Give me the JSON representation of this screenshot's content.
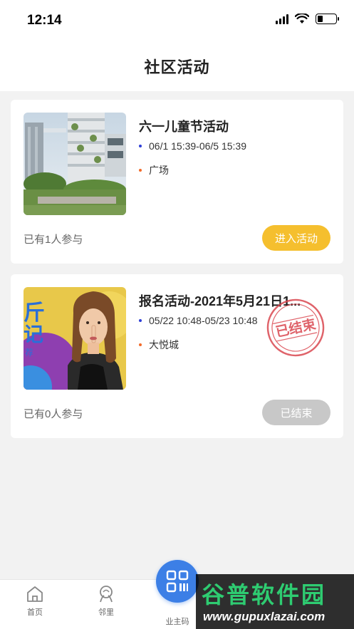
{
  "status_bar": {
    "time": "12:14"
  },
  "header": {
    "title": "社区活动"
  },
  "activities": [
    {
      "title": "六一儿童节活动",
      "time": "06/1 15:39-06/5 15:39",
      "place": "广场",
      "participants": "已有1人参与",
      "button": "进入活动",
      "state": "active"
    },
    {
      "title": "报名活动-2021年5月21日1...",
      "time": "05/22 10:48-05/23 10:48",
      "place": "大悦城",
      "participants": "已有0人参与",
      "button": "已结束",
      "stamp": "已结束",
      "state": "ended"
    }
  ],
  "tabbar": {
    "items": [
      {
        "label": "首页",
        "icon": "home-icon"
      },
      {
        "label": "邻里",
        "icon": "neighbor-icon"
      },
      {
        "label": "业主码",
        "icon": "qr-code-icon"
      }
    ]
  },
  "watermark": {
    "title": "谷普软件园",
    "url": "www.gupuxlazai.com"
  },
  "colors": {
    "accent": "#f5bf2e",
    "ended": "#c8c8c8",
    "fab": "#3c7fe6",
    "stamp": "#d9414a"
  }
}
